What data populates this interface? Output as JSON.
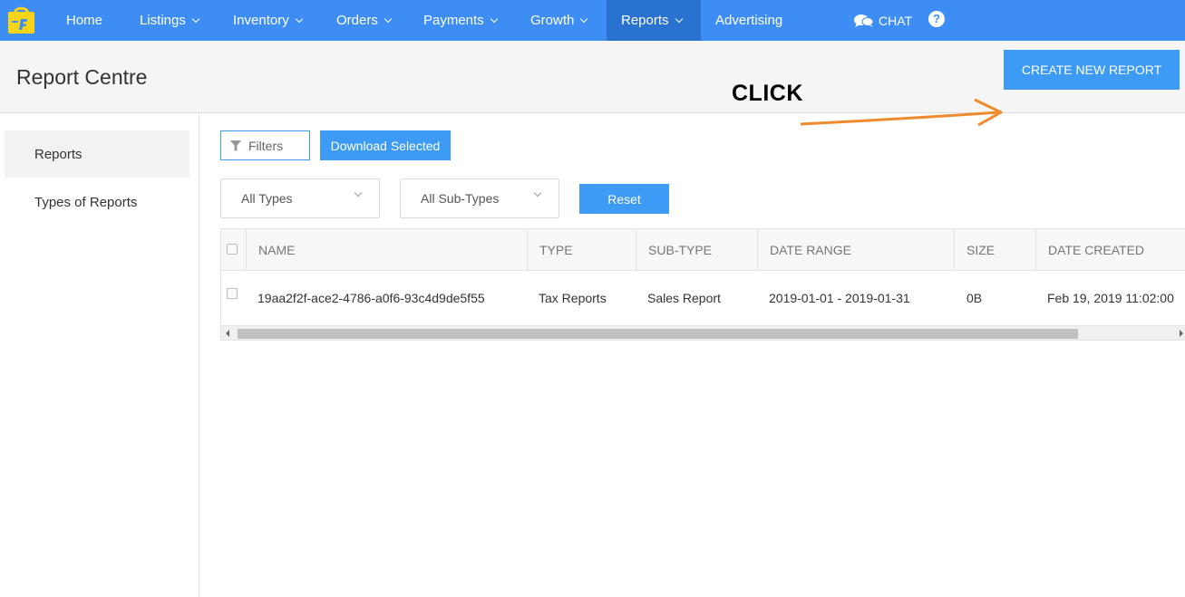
{
  "nav": {
    "items": [
      {
        "label": "Home"
      },
      {
        "label": "Listings"
      },
      {
        "label": "Inventory"
      },
      {
        "label": "Orders"
      },
      {
        "label": "Payments"
      },
      {
        "label": "Growth"
      },
      {
        "label": "Reports"
      },
      {
        "label": "Advertising"
      }
    ],
    "chat_label": "CHAT",
    "help_label": "?",
    "active": "Reports"
  },
  "header": {
    "title": "Report Centre",
    "create_button": "CREATE NEW REPORT",
    "annotation": "CLICK"
  },
  "sidebar": {
    "items": [
      {
        "label": "Reports"
      },
      {
        "label": "Types of Reports"
      }
    ]
  },
  "toolbar": {
    "filters_label": "Filters",
    "download_label": "Download Selected",
    "type_select": "All Types",
    "subtype_select": "All Sub-Types",
    "reset_label": "Reset"
  },
  "table": {
    "columns": [
      "NAME",
      "TYPE",
      "SUB-TYPE",
      "DATE RANGE",
      "SIZE",
      "DATE CREATED"
    ],
    "rows": [
      {
        "name": "19aa2f2f-ace2-4786-a0f6-93c4d9de5f55",
        "type": "Tax Reports",
        "subtype": "Sales Report",
        "date_range": "2019-01-01 - 2019-01-31",
        "size": "0B",
        "date_created": "Feb 19, 2019 11:02:00"
      }
    ]
  },
  "colors": {
    "primary": "#3d8df5",
    "button": "#3d9af5",
    "active_nav": "#2a72cf",
    "annotation_arrow": "#f08a2c"
  }
}
